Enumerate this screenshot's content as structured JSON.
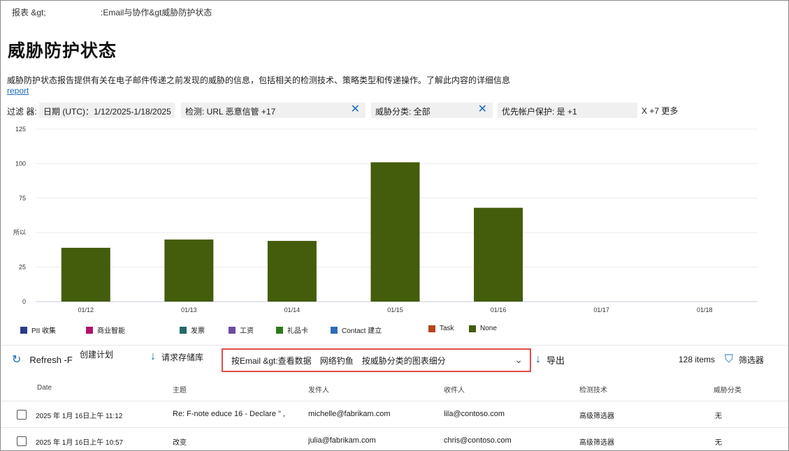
{
  "breadcrumb": {
    "first": "报表 &gt;",
    "second": ":Email与协作&gt威胁防护状态"
  },
  "page_title": "威胁防护状态",
  "description": "威胁防护状态报告提供有关在电子邮件传递之前发现的威胁的信息，包括相关的检测技术、策略类型和传递操作。了解此内容的详细信息",
  "description_link": "report",
  "filters": {
    "label": "过滤 器:",
    "date": "日期 (UTC)：1/12/2025-1/18/2025",
    "detection": "检测: URL 恶意信管 +17",
    "category": "威胁分类: 全部",
    "priority": "优先帐户保护: 是 +1",
    "more": "X +7 更多"
  },
  "chart_data": {
    "type": "bar",
    "categories": [
      "01/12",
      "01/13",
      "01/14",
      "01/15",
      "01/16",
      "01/17",
      "01/18"
    ],
    "values": [
      39,
      45,
      44,
      101,
      68,
      0,
      0
    ],
    "yticks": [
      "0",
      "25",
      "所以",
      "75",
      "100",
      "125"
    ],
    "ylim": [
      0,
      125
    ],
    "bar_color": "#435d0c",
    "grid": true
  },
  "legend": [
    {
      "label": "PII 收集",
      "color": "#2e3a8c"
    },
    {
      "label": "商业智能",
      "color": "#b0126b"
    },
    {
      "label": "发票",
      "color": "#1f6b6b"
    },
    {
      "label": "工资",
      "color": "#6c4ca3"
    },
    {
      "label": "礼品卡",
      "color": "#2d7a1a"
    },
    {
      "label": "Contact 建立",
      "color": "#2f6db5"
    },
    {
      "label": "Task",
      "color": "#b4441b"
    },
    {
      "label": "None",
      "color": "#435d0c"
    }
  ],
  "toolbar": {
    "refresh": "Refresh -F",
    "create_plan": "创建计划",
    "request_repo": "请求存储库",
    "dropdown_a": "按Email &gt:查看数据",
    "dropdown_b": "网络钓鱼",
    "dropdown_c": "按威胁分类的图表细分",
    "export": "导出",
    "items": "128 items",
    "filter": "筛选器"
  },
  "table": {
    "headers": [
      "Date",
      "主题",
      "发件人",
      "收件人",
      "检测技术",
      "威胁分类"
    ],
    "rows": [
      {
        "date": "2025 年 1月 16日上午 11:12",
        "subject": "Re: F-note educe 16 - Declare \" ,",
        "sender": "michelle@fabrikam.com",
        "recipient": "lila@contoso.com",
        "tech": "高级筛选器",
        "category": "无"
      },
      {
        "date": "2025 年 1月 16日上午 10:57",
        "subject": "改变",
        "sender": "julia@fabrikam.com",
        "recipient": "chris@contoso.com",
        "tech": "高级筛选器",
        "category": "无"
      }
    ]
  }
}
